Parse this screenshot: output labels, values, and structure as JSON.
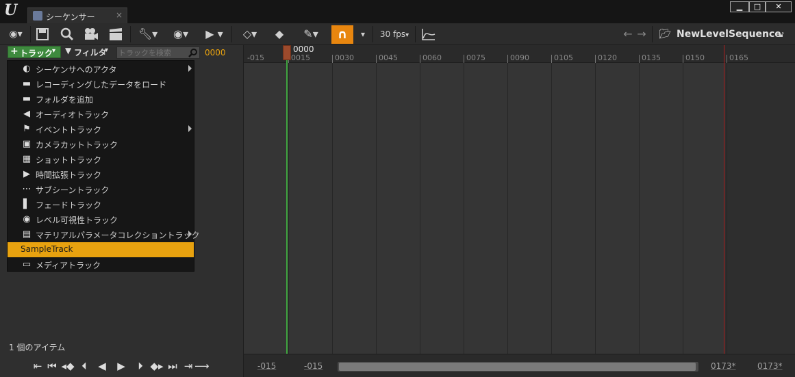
{
  "window": {
    "logo": "U",
    "tab_title": "シーケンサー",
    "tab_close": "×",
    "min": "▁",
    "max": "□",
    "close": "✕"
  },
  "toolbar": {
    "fps_label": "30 fps",
    "sequence_name": "NewLevelSequence",
    "snap_color": "#e8860f"
  },
  "left": {
    "track_button": "トラック",
    "filter_button": "フィルタ",
    "search_placeholder": "トラックを検索",
    "current_frame": "0000",
    "item_count": "1 個のアイテム"
  },
  "menu": {
    "items": [
      {
        "label": "シーケンサへのアクタ",
        "icon": "actor-icon",
        "submenu": true
      },
      {
        "label": "レコーディングしたデータをロード",
        "icon": "folder-icon",
        "submenu": false
      },
      {
        "label": "フォルダを追加",
        "icon": "folder-icon",
        "submenu": false
      },
      {
        "label": "オーディオトラック",
        "icon": "speaker-icon",
        "submenu": false
      },
      {
        "label": "イベントトラック",
        "icon": "flag-icon",
        "submenu": true
      },
      {
        "label": "カメラカットトラック",
        "icon": "camera-icon",
        "submenu": false
      },
      {
        "label": "ショットトラック",
        "icon": "film-icon",
        "submenu": false
      },
      {
        "label": "時間拡張トラック",
        "icon": "play-icon",
        "submenu": false
      },
      {
        "label": "サブシーントラック",
        "icon": "dots-icon",
        "submenu": false
      },
      {
        "label": "フェードトラック",
        "icon": "gradient-icon",
        "submenu": false
      },
      {
        "label": "レベル可視性トラック",
        "icon": "eye-icon",
        "submenu": false
      },
      {
        "label": "マテリアルパラメータコレクショントラック",
        "icon": "material-icon",
        "submenu": true
      },
      {
        "label": "SampleTrack",
        "icon": "",
        "submenu": false,
        "selected": true
      },
      {
        "label": "メディアトラック",
        "icon": "media-icon",
        "submenu": false
      }
    ]
  },
  "timeline": {
    "playhead_label": "0000",
    "ticks": [
      "-015",
      "0015",
      "0030",
      "0045",
      "0060",
      "0075",
      "0090",
      "0105",
      "0120",
      "0135",
      "0150",
      "0165"
    ],
    "bottom_left_start": "-015",
    "bottom_left_end": "-015",
    "bottom_right_start": "0173*",
    "bottom_right_end": "0173*",
    "start_marker_color": "#3fa43f",
    "end_marker_color": "#b02020"
  }
}
